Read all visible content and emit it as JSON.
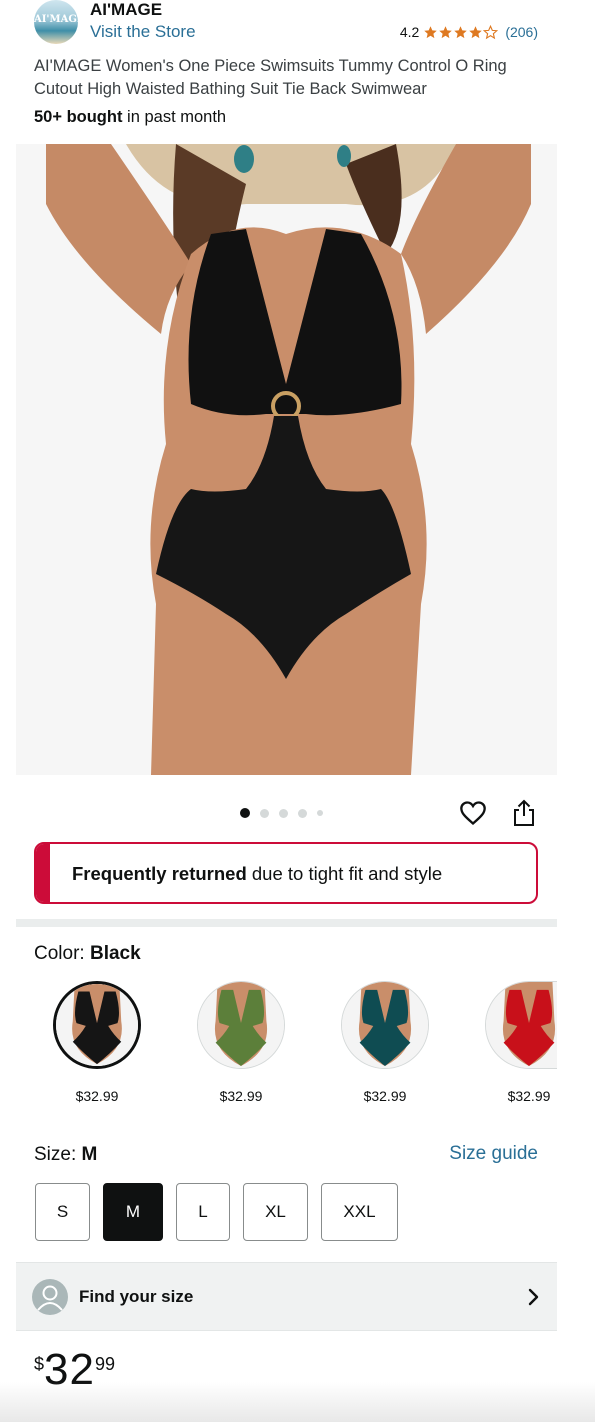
{
  "header": {
    "logo_text": "AI'MAGE",
    "brand_name": "AI'MAGE",
    "visit_store": "Visit the Store",
    "rating": "4.2",
    "stars_filled": 4,
    "rating_count": "(206)"
  },
  "product": {
    "title": "AI'MAGE Women's One Piece Swimsuits Tummy Control O Ring Cutout High Waisted Bathing Suit Tie Back Swimwear",
    "bought_bold": "50+ bought",
    "bought_rest": " in past month"
  },
  "carousel": {
    "count": 5,
    "active_index": 0
  },
  "alert": {
    "bold": "Frequently returned",
    "rest": " due to tight fit and style"
  },
  "color": {
    "label": "Color: ",
    "selected": "Black",
    "options": [
      {
        "name": "black-swatch",
        "color": "#151515",
        "price": "$32.99",
        "selected": true
      },
      {
        "name": "green-swatch",
        "color": "#5c7f3a",
        "price": "$32.99",
        "selected": false
      },
      {
        "name": "teal-swatch",
        "color": "#0f4c52",
        "price": "$32.99",
        "selected": false
      },
      {
        "name": "red-swatch",
        "color": "#c8101a",
        "price": "$32.99",
        "selected": false
      }
    ]
  },
  "size": {
    "label": "Size: ",
    "selected": "M",
    "guide": "Size guide",
    "options": [
      "S",
      "M",
      "L",
      "XL",
      "XXL"
    ]
  },
  "find_size": {
    "label": "Find your size"
  },
  "price": {
    "symbol": "$",
    "whole": "32",
    "fraction": "99"
  },
  "colors": {
    "link": "#2a6f96",
    "star": "#de7921",
    "alert": "#cc0c39"
  }
}
